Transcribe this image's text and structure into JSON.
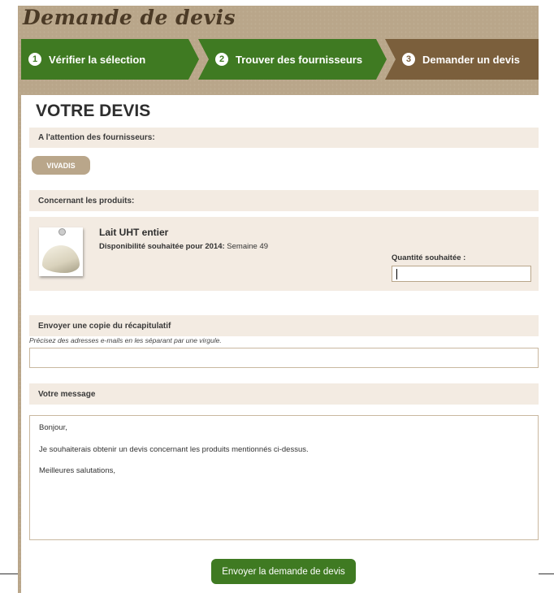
{
  "page": {
    "title": "Demande de devis"
  },
  "steps": [
    {
      "number": "1",
      "label": "Vérifier la sélection"
    },
    {
      "number": "2",
      "label": "Trouver des fournisseurs"
    },
    {
      "number": "3",
      "label": "Demander un devis"
    }
  ],
  "quote": {
    "heading": "VOTRE DEVIS",
    "suppliers_label": "A l'attention des fournisseurs:",
    "supplier_tag": "VIVADIS",
    "products_label": "Concernant les produits:",
    "product": {
      "name": "Lait UHT entier",
      "availability_label": "Disponibilité souhaitée pour 2014:",
      "availability_value": " Semaine 49",
      "quantity_label": "Quantité souhaitée :",
      "quantity_value": ""
    },
    "copy_label": "Envoyer une copie du récapitulatif",
    "copy_hint": "Précisez des adresses e-mails en les séparant par une virgule.",
    "email_value": "",
    "message_label": "Votre message",
    "message_lines": [
      "Bonjour,",
      "Je souhaiterais obtenir un devis concernant les produits mentionnés ci-dessus.",
      "Meilleures salutations,"
    ],
    "submit_label": "Envoyer la demande de devis"
  },
  "colors": {
    "green": "#3f7a22",
    "brown": "#7b5f3c",
    "tan": "#b9a68a",
    "beige": "#f3ebe2"
  },
  "icons": {
    "product_thumbnail": "milk-pitcher-icon"
  }
}
